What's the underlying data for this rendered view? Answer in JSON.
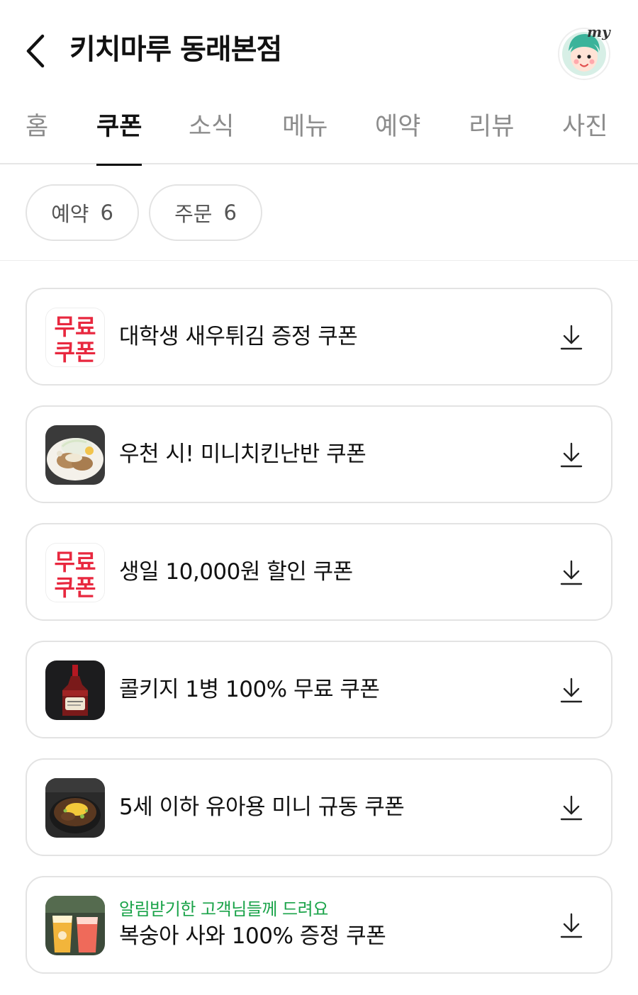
{
  "header": {
    "title": "키치마루 동래본점",
    "my_label": "my"
  },
  "tabs": [
    {
      "label": "홈",
      "active": false
    },
    {
      "label": "쿠폰",
      "active": true
    },
    {
      "label": "소식",
      "active": false
    },
    {
      "label": "메뉴",
      "active": false
    },
    {
      "label": "예약",
      "active": false
    },
    {
      "label": "리뷰",
      "active": false
    },
    {
      "label": "사진",
      "active": false
    }
  ],
  "filters": [
    {
      "label": "예약",
      "count": "6"
    },
    {
      "label": "주문",
      "count": "6"
    }
  ],
  "free_badge": {
    "line1": "무료",
    "line2": "쿠폰"
  },
  "coupons": [
    {
      "title": "대학생 새우튀김 증정 쿠폰",
      "subtitle": "",
      "thumb": "free-coupon-badge"
    },
    {
      "title": "우천 시! 미니치킨난반 쿠폰",
      "subtitle": "",
      "thumb": "chicken-nanban-photo"
    },
    {
      "title": "생일 10,000원 할인 쿠폰",
      "subtitle": "",
      "thumb": "free-coupon-badge"
    },
    {
      "title": "콜키지 1병 100% 무료 쿠폰",
      "subtitle": "",
      "thumb": "whisky-bottle-photo"
    },
    {
      "title": "5세 이하 유아용 미니 규동 쿠폰",
      "subtitle": "",
      "thumb": "gyudon-bowl-photo"
    },
    {
      "title": "복숭아 사와 100% 증정 쿠폰",
      "subtitle": "알림받기한 고객님들께 드려요",
      "thumb": "peach-sour-drinks-photo"
    }
  ],
  "colors": {
    "accent_green": "#1aa349",
    "badge_red": "#e8283f",
    "text_primary": "#111111",
    "text_inactive": "#8c8c8c",
    "border": "#e3e3e3"
  }
}
